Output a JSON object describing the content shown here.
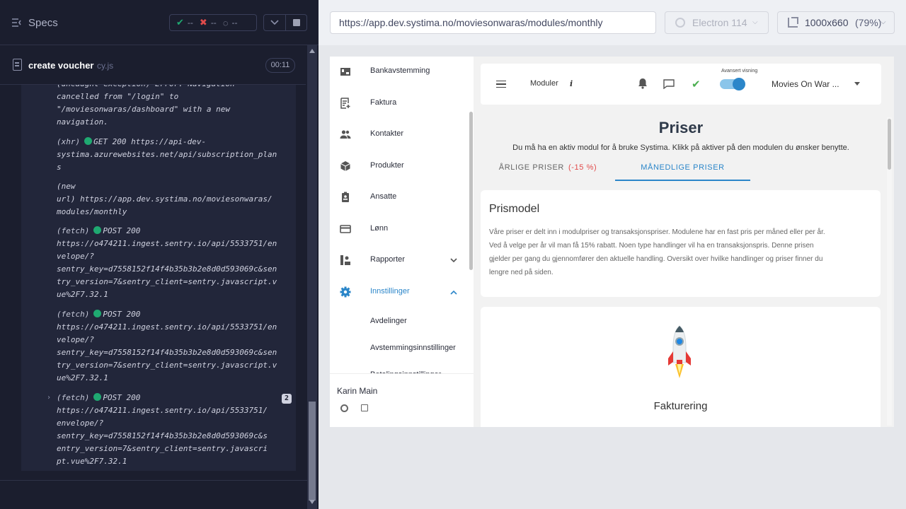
{
  "runner": {
    "specs_label": "Specs",
    "stats": {
      "passed": "--",
      "failed": "--",
      "pending": "--"
    },
    "spec_name": "create voucher",
    "spec_ext": "cy.js",
    "spec_time": "00:11",
    "log": [
      {
        "lines": [
          "(uncaught exception) Error: Navigation",
          "cancelled from \"/login\" to",
          "\"/moviesonwaras/dashboard\" with a new",
          "navigation."
        ]
      },
      {
        "kind": "(xhr)",
        "method": "GET 200",
        "lines_after": [
          "https://api-dev-",
          "systima.azurewebsites.net/api/subscription_plan",
          "s"
        ]
      },
      {
        "kind": "(new",
        "lines_after": [
          "url)  https://app.dev.systima.no/moviesonwaras/",
          "modules/monthly"
        ]
      },
      {
        "kind": "(fetch)",
        "method": "POST 200",
        "lines_after": [
          "https://o474211.ingest.sentry.io/api/5533751/en",
          "velope/?",
          "sentry_key=d7558152f14f4b35b3b2e8d0d593069c&sen",
          "try_version=7&sentry_client=sentry.javascript.v",
          "ue%2F7.32.1"
        ]
      },
      {
        "kind": "(fetch)",
        "method": "POST 200",
        "lines_after": [
          "https://o474211.ingest.sentry.io/api/5533751/en",
          "velope/?",
          "sentry_key=d7558152f14f4b35b3b2e8d0d593069c&sen",
          "try_version=7&sentry_client=sentry.javascript.v",
          "ue%2F7.32.1"
        ]
      },
      {
        "kind": "(fetch)",
        "method": "POST 200",
        "count": "2",
        "lines_after": [
          "https://o474211.ingest.sentry.io/api/5533751/",
          "envelope/?",
          "sentry_key=d7558152f14f4b35b3b2e8d0d593069c&s",
          "entry_version=7&sentry_client=sentry.javascri",
          "pt.vue%2F7.32.1"
        ]
      }
    ]
  },
  "aut": {
    "url": "https://app.dev.systima.no/moviesonwaras/modules/monthly",
    "browser": "Electron 114",
    "viewport": "1000x660",
    "scale": "(79%)"
  },
  "app": {
    "nav": [
      {
        "label": "Bankavstemming",
        "icon": "bank-icon"
      },
      {
        "label": "Faktura",
        "icon": "invoice-icon"
      },
      {
        "label": "Kontakter",
        "icon": "contacts-icon"
      },
      {
        "label": "Produkter",
        "icon": "box-icon"
      },
      {
        "label": "Ansatte",
        "icon": "badge-icon"
      },
      {
        "label": "Lønn",
        "icon": "card-icon"
      },
      {
        "label": "Rapporter",
        "icon": "reports-icon"
      },
      {
        "label": "Innstillinger",
        "icon": "gear-icon"
      }
    ],
    "nav_sub": [
      "Avdelinger",
      "Avstemmingsinnstillinger",
      "Betalingsinnstillinger"
    ],
    "user_name": "Karin Main",
    "topbar": {
      "modules_label": "Moduler",
      "info": "i",
      "advanced_label": "Avansert visning",
      "company": "Movies On War ..."
    },
    "title": "Priser",
    "subtitle": "Du må ha en aktiv modul for å bruke Systima. Klikk på aktiver på den modulen du ønsker benytte.",
    "tabs": {
      "yearly": "ÅRLIGE PRISER",
      "yearly_discount": "(-15 %)",
      "monthly": "MÅNEDLIGE PRISER"
    },
    "prismodel": {
      "title": "Prismodel",
      "lines": [
        "Våre priser er delt inn i modulpriser og transaksjonspriser. Modulene har en fast pris per måned eller per år.",
        "Ved å velge per år vil man få 15% rabatt. Noen type handlinger vil ha en transaksjonspris. Denne prisen",
        "gjelder per gang du gjennomfører den aktuelle handling. Oversikt over hvilke handlinger og priser finner du",
        "lengre ned på siden."
      ]
    },
    "fakturering_title": "Fakturering"
  },
  "colors": {
    "accent": "#2b86c9",
    "pass": "#1fa971",
    "fail": "#e14b4b"
  }
}
